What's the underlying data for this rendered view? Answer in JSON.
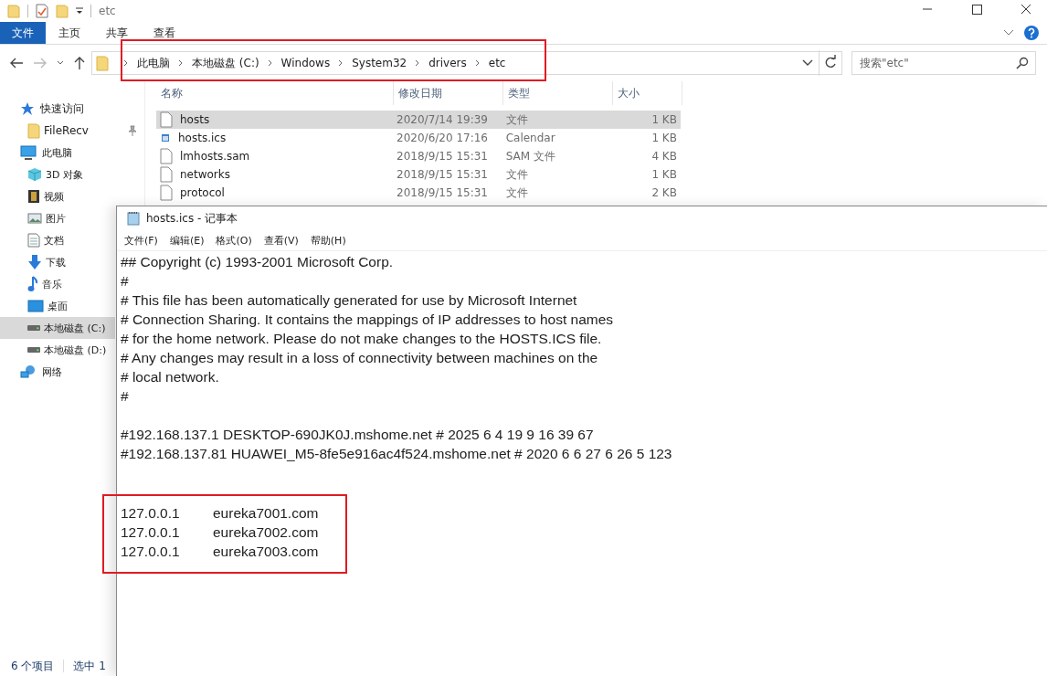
{
  "explorer": {
    "title": "etc",
    "ribbon_tabs": [
      {
        "label": "文件",
        "selected": true
      },
      {
        "label": "主页",
        "selected": false
      },
      {
        "label": "共享",
        "selected": false
      },
      {
        "label": "查看",
        "selected": false
      }
    ],
    "address_bar": {
      "highlighted": true,
      "crumbs": [
        "此电脑",
        "本地磁盘 (C:)",
        "Windows",
        "System32",
        "drivers",
        "etc"
      ]
    },
    "search": {
      "placeholder": "搜索\"etc\""
    },
    "sidebar": {
      "items": [
        {
          "label": "快速访问",
          "selected": false,
          "children": [
            {
              "label": "FileRecv",
              "selected": false
            }
          ]
        },
        {
          "label": "此电脑",
          "selected": false,
          "children": [
            {
              "label": "3D 对象",
              "selected": false
            },
            {
              "label": "视频",
              "selected": false
            },
            {
              "label": "图片",
              "selected": false
            },
            {
              "label": "文档",
              "selected": false
            },
            {
              "label": "下载",
              "selected": false
            },
            {
              "label": "音乐",
              "selected": false
            },
            {
              "label": "桌面",
              "selected": false
            },
            {
              "label": "本地磁盘 (C:)",
              "selected": true
            },
            {
              "label": "本地磁盘 (D:)",
              "selected": false
            }
          ]
        },
        {
          "label": "网络",
          "selected": false
        }
      ]
    },
    "table": {
      "columns": [
        "名称",
        "修改日期",
        "类型",
        "大小"
      ],
      "rows": [
        {
          "name": "hosts",
          "date": "2020/7/14 19:39",
          "type": "文件",
          "size": "1 KB",
          "kind": "file",
          "selected": true
        },
        {
          "name": "hosts.ics",
          "date": "2020/6/20 17:16",
          "type": "Calendar",
          "size": "1 KB",
          "kind": "calendar",
          "selected": false
        },
        {
          "name": "lmhosts.sam",
          "date": "2018/9/15 15:31",
          "type": "SAM 文件",
          "size": "4 KB",
          "kind": "file",
          "selected": false
        },
        {
          "name": "networks",
          "date": "2018/9/15 15:31",
          "type": "文件",
          "size": "1 KB",
          "kind": "file",
          "selected": false
        },
        {
          "name": "protocol",
          "date": "2018/9/15 15:31",
          "type": "文件",
          "size": "2 KB",
          "kind": "file",
          "selected": false
        }
      ]
    },
    "status_bar": [
      "6 个项目",
      "选中 1"
    ]
  },
  "notepad": {
    "title": "hosts.ics - 记事本",
    "menu": [
      "文件(F)",
      "编辑(E)",
      "格式(O)",
      "查看(V)",
      "帮助(H)"
    ],
    "blocks": [
      {
        "highlighted": false,
        "lines": [
          {
            "kind": "text",
            "text": "## Copyright (c) 1993-2001 Microsoft Corp."
          },
          {
            "kind": "text",
            "text": "#"
          },
          {
            "kind": "text",
            "text": "# This file has been automatically generated for use by Microsoft Internet"
          },
          {
            "kind": "text",
            "text": "# Connection Sharing. It contains the mappings of IP addresses to host names"
          },
          {
            "kind": "text",
            "text": "# for the home network. Please do not make changes to the HOSTS.ICS file."
          },
          {
            "kind": "text",
            "text": "# Any changes may result in a loss of connectivity between machines on the"
          },
          {
            "kind": "text",
            "text": "# local network."
          },
          {
            "kind": "text",
            "text": "#"
          },
          {
            "kind": "blank"
          },
          {
            "kind": "text",
            "text": "#192.168.137.1 DESKTOP-690JK0J.mshome.net # 2025 6 4 19 9 16 39 67"
          },
          {
            "kind": "text",
            "text": "#192.168.137.81 HUAWEI_M5-8fe5e916ac4f524.mshome.net # 2020 6 6 27 6 26 5 123"
          },
          {
            "kind": "blank"
          },
          {
            "kind": "blank"
          }
        ]
      },
      {
        "highlighted": true,
        "lines": [
          {
            "kind": "entry",
            "ip": "127.0.0.1",
            "host": "eureka7001.com"
          },
          {
            "kind": "entry",
            "ip": "127.0.0.1",
            "host": "eureka7002.com"
          },
          {
            "kind": "entry",
            "ip": "127.0.0.1",
            "host": "eureka7003.com"
          }
        ]
      }
    ]
  }
}
